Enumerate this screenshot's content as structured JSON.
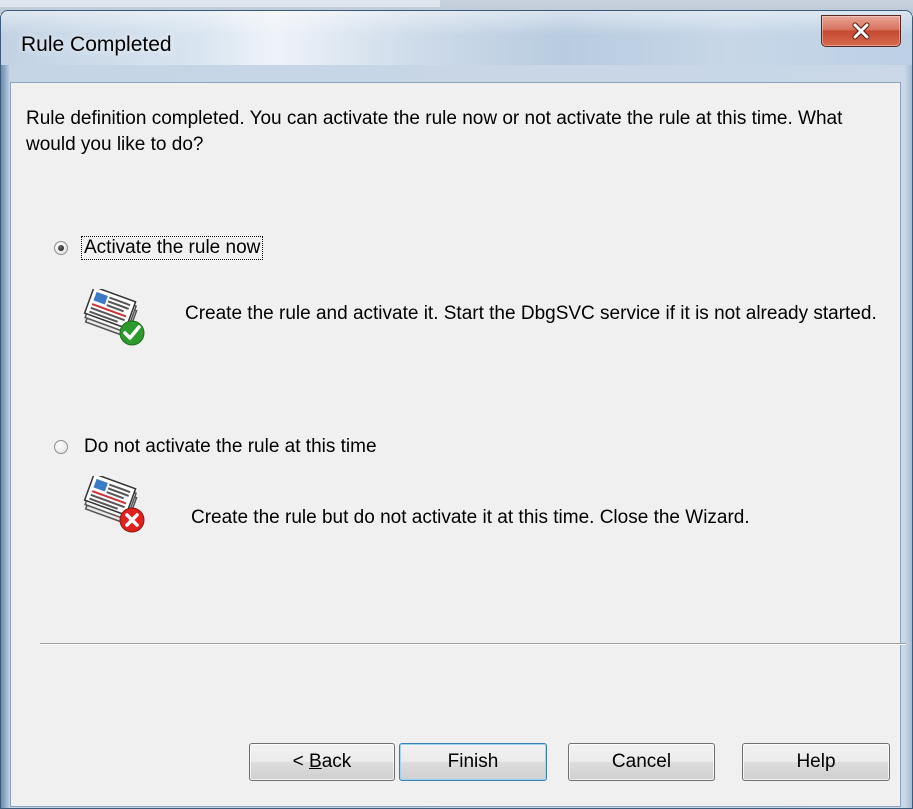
{
  "window": {
    "title": "Rule Completed",
    "close_glyph": "X"
  },
  "intro_text": "Rule definition completed. You can activate the rule now or not activate the rule at this time. What would you like to do?",
  "options": [
    {
      "label": "Activate the rule now",
      "checked": true,
      "description": "Create the rule and activate it. Start the DbgSVC service if it is not already started.",
      "icon": "rule-activate-icon"
    },
    {
      "label": "Do not activate the rule at this time",
      "checked": false,
      "description": "Create the rule but do not activate it at this time. Close the Wizard.",
      "icon": "rule-deactivate-icon"
    }
  ],
  "buttons": {
    "back_prefix": "< ",
    "back_mnemonic": "B",
    "back_rest": "ack",
    "finish": "Finish",
    "cancel": "Cancel",
    "help": "Help"
  }
}
